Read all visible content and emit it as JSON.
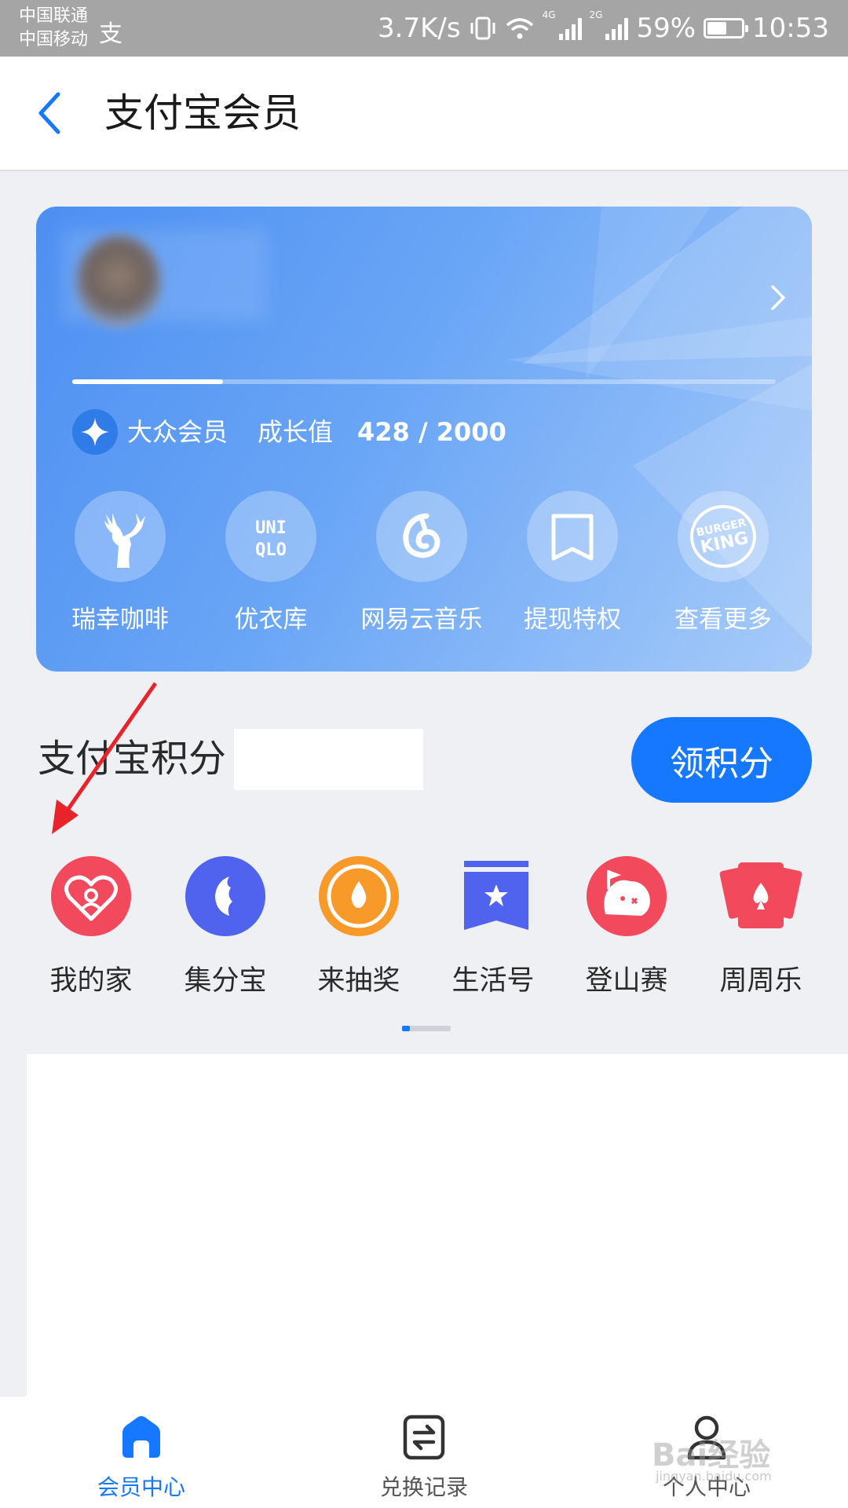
{
  "status_bar": {
    "carrier_1": "中国联通",
    "carrier_2": "中国移动",
    "app_icon": "alipay-icon",
    "speed": "3.7K/s",
    "net_4g": "4G",
    "net_2g": "2G",
    "battery": "59%",
    "battery_level": 0.59,
    "time": "10:53"
  },
  "header": {
    "title": "支付宝会员",
    "back_icon": "chevron-left-icon"
  },
  "member_card": {
    "level_name": "大众会员",
    "growth_label": "成长值",
    "growth_value": "428 / 2000",
    "growth_current": 428,
    "growth_target": 2000,
    "benefits": [
      {
        "label": "瑞幸咖啡",
        "icon": "luckin-deer-icon"
      },
      {
        "label": "优衣库",
        "icon": "uniqlo-logo-icon",
        "logo_text": "UNI QLO"
      },
      {
        "label": "网易云音乐",
        "icon": "netease-music-icon"
      },
      {
        "label": "提现特权",
        "icon": "bookmark-icon"
      },
      {
        "label": "查看更多",
        "icon": "burger-king-icon",
        "logo_text": "BURGER KING"
      }
    ]
  },
  "points": {
    "title": "支付宝积分",
    "earn_button": "领积分"
  },
  "services": [
    {
      "label": "我的家",
      "icon": "family-heart-icon",
      "color": "#f24a5c"
    },
    {
      "label": "集分宝",
      "icon": "jifenbao-icon",
      "color": "#4f63ee"
    },
    {
      "label": "来抽奖",
      "icon": "lottery-icon",
      "color": "#f89a2a"
    },
    {
      "label": "生活号",
      "icon": "life-account-icon",
      "color": "#4f63ee"
    },
    {
      "label": "登山赛",
      "icon": "mountain-race-icon",
      "color": "#f24a5c"
    },
    {
      "label": "周周乐",
      "icon": "weekly-cards-icon",
      "color": "#f24a5c"
    }
  ],
  "tabbar": {
    "tabs": [
      {
        "label": "会员中心",
        "icon": "home-icon",
        "active": true
      },
      {
        "label": "兑换记录",
        "icon": "exchange-record-icon",
        "active": false
      },
      {
        "label": "个人中心",
        "icon": "profile-icon",
        "active": false
      }
    ]
  },
  "watermark": {
    "text": "Bai经验",
    "url": "jingyan.baidu.com"
  },
  "colors": {
    "primary": "#1677ff",
    "card_gradient_start": "#4d8ff2",
    "card_gradient_end": "#a7cbf9",
    "annotation": "#e8232a"
  }
}
